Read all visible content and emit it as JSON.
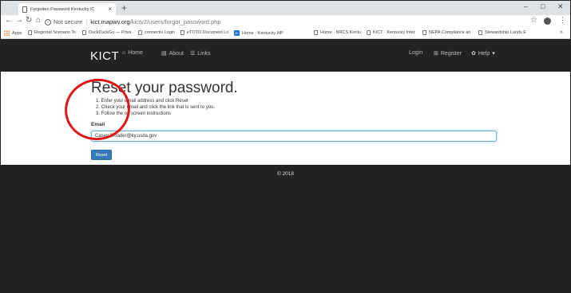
{
  "browser": {
    "tab_title": "Forgotten Password Kentucky IC",
    "url_security": "Not secure",
    "url_host": "kict.mapwv.org",
    "url_path": "/kictv2/users/forgot_password.php",
    "bookmarks": [
      {
        "label": "Apps"
      },
      {
        "label": "Regional Scenario To"
      },
      {
        "label": "DuckDuckGo — Priva"
      },
      {
        "label": "connectiv Login"
      },
      {
        "label": "eTOTO Document Lo"
      },
      {
        "label": "Home · Kentucky NP"
      },
      {
        "label": "Home · NRCS Kentu"
      },
      {
        "label": "KICT · Kentucky Inter"
      },
      {
        "label": "NEPA Compliance an"
      },
      {
        "label": "Stewardship Lands E"
      }
    ]
  },
  "site": {
    "brand": "KICT",
    "nav": {
      "home": "Home",
      "about": "About",
      "links": "Links",
      "login": "Login",
      "register": "Register",
      "help": "Help"
    },
    "heading": "Reset your password.",
    "steps": [
      "1. Enter your email address and click Reset",
      "2. Check your email and click the link that is sent to you.",
      "3. Follow the on screen instructions"
    ],
    "email_label": "Email",
    "email_value": "Casey.Shrader@ky.usda.gov",
    "reset_label": "Reset",
    "footer": "© 2018"
  },
  "colors": {
    "navbar_bg": "#222222",
    "primary_button": "#337ab7",
    "annotation": "#e21515"
  }
}
